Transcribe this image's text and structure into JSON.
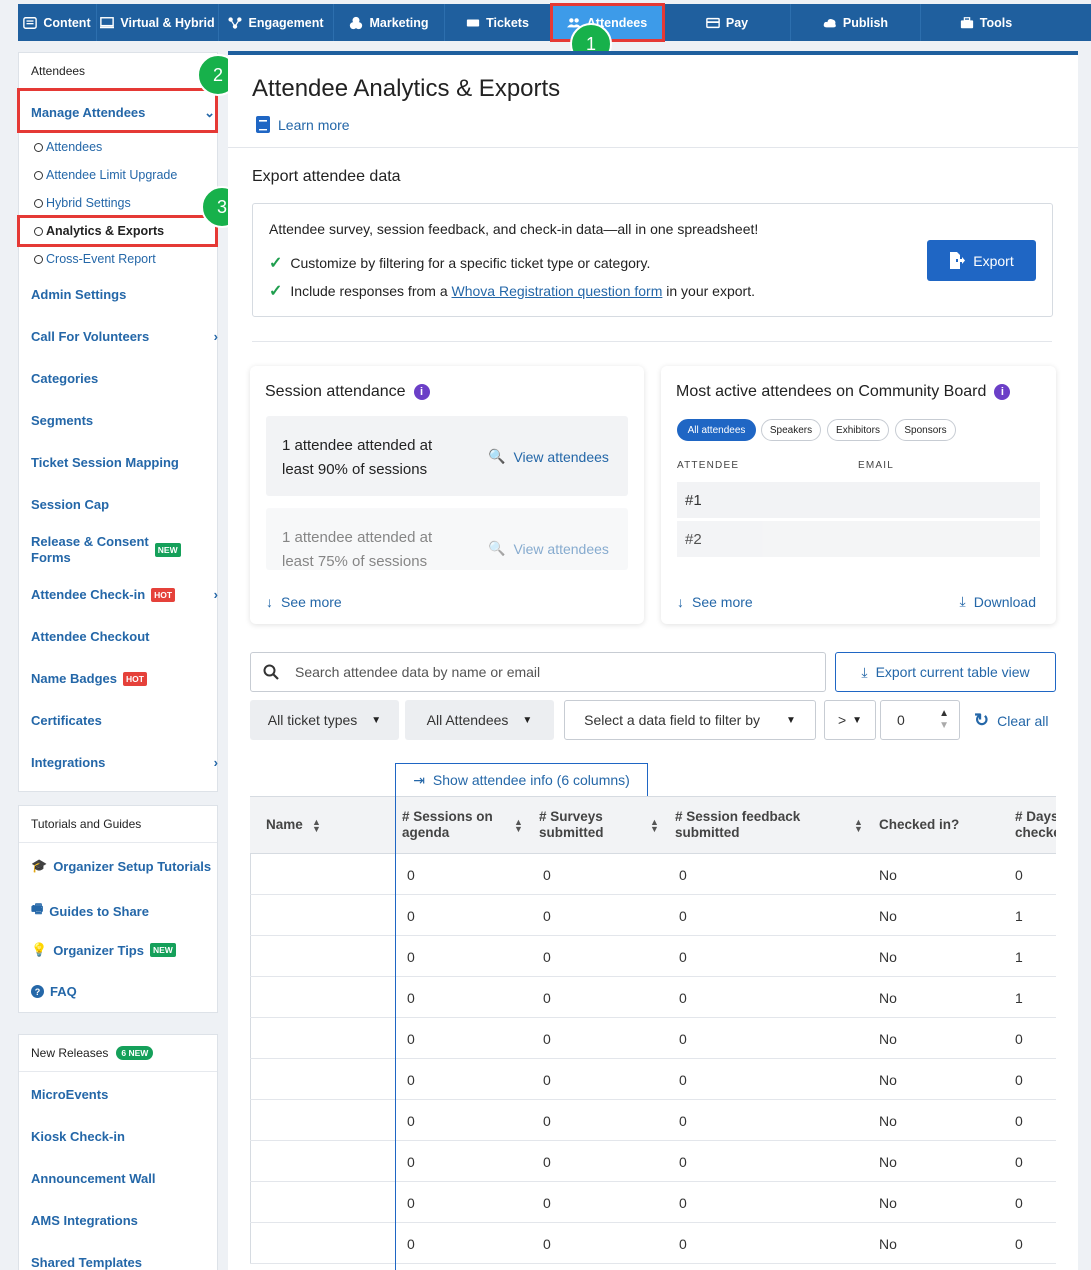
{
  "topnav": [
    {
      "label": "Content",
      "icon": "content-icon"
    },
    {
      "label": "Virtual & Hybrid",
      "icon": "monitor-icon"
    },
    {
      "label": "Engagement",
      "icon": "engagement-icon"
    },
    {
      "label": "Marketing",
      "icon": "marketing-icon"
    },
    {
      "label": "Tickets",
      "icon": "ticket-icon"
    },
    {
      "label": "Attendees",
      "icon": "attendees-icon",
      "active": true
    },
    {
      "label": "Pay",
      "icon": "card-icon"
    },
    {
      "label": "Publish",
      "icon": "cloud-upload-icon"
    },
    {
      "label": "Tools",
      "icon": "toolbox-icon"
    }
  ],
  "steps": [
    "1",
    "2",
    "3"
  ],
  "sidebar": {
    "header": "Attendees",
    "manage": "Manage Attendees",
    "sub": [
      "Attendees",
      "Attendee Limit Upgrade",
      "Hybrid Settings",
      "Analytics & Exports",
      "Cross-Event Report"
    ],
    "links": [
      {
        "label": "Admin Settings"
      },
      {
        "label": "Call For Volunteers",
        "chevron": true
      },
      {
        "label": "Categories"
      },
      {
        "label": "Segments"
      },
      {
        "label": "Ticket Session Mapping"
      },
      {
        "label": "Session Cap"
      },
      {
        "label": "Release & Consent",
        "label2": "Forms",
        "badge": "NEW"
      },
      {
        "label": "Attendee Check-in",
        "badge": "HOT",
        "chevron": true
      },
      {
        "label": "Attendee Checkout"
      },
      {
        "label": "Name Badges",
        "badge": "HOT"
      },
      {
        "label": "Certificates"
      },
      {
        "label": "Integrations",
        "chevron": true
      }
    ],
    "tutorials_header": "Tutorials and Guides",
    "tutorials": [
      {
        "label": "Organizer Setup Tutorials",
        "icon": "graduation-cap-icon"
      },
      {
        "label": "Guides to Share",
        "icon": "presentation-icon"
      },
      {
        "label": "Organizer Tips",
        "icon": "lightbulb-icon",
        "badge": "NEW"
      },
      {
        "label": "FAQ",
        "icon": "question-icon"
      }
    ],
    "releases_header": "New Releases",
    "releases_badge": "6 NEW",
    "releases": [
      "MicroEvents",
      "Kiosk Check-in",
      "Announcement Wall",
      "AMS Integrations",
      "Shared Templates"
    ]
  },
  "main": {
    "title": "Attendee Analytics & Exports",
    "learn_more": "Learn more",
    "export_section": "Export attendee data",
    "export_line1": "Attendee survey, session feedback, and check-in data—all in one spreadsheet!",
    "export_line2": "Customize by filtering for a specific ticket type or category.",
    "export_line3_pre": "Include responses from a",
    "export_line3_link": "Whova Registration question form",
    "export_line3_post": "in your export.",
    "export_button": "Export",
    "session_card": {
      "title": "Session attendance",
      "rows": [
        {
          "text": "1 attendee attended at least 90% of sessions",
          "link": "View attendees"
        },
        {
          "text": "1 attendee attended at least 75% of sessions",
          "link": "View attendees"
        }
      ],
      "see_more": "See more"
    },
    "board_card": {
      "title": "Most active attendees on Community Board",
      "pills": [
        "All attendees",
        "Speakers",
        "Exhibitors",
        "Sponsors"
      ],
      "col_attendee": "ATTENDEE",
      "col_email": "EMAIL",
      "rows": [
        "#1",
        "#2"
      ],
      "see_more": "See more",
      "download": "Download"
    },
    "search_placeholder": "Search attendee data by name or email",
    "export_table": "Export current table view",
    "filters": {
      "ticket": "All ticket types",
      "attendees": "All Attendees",
      "field": "Select a data field to filter by",
      "op": ">",
      "value": "0",
      "clear": "Clear all"
    },
    "show_info": "Show attendee info (6 columns)",
    "table": {
      "headers": [
        "Name",
        "# Sessions on agenda",
        "# Surveys submitted",
        "# Session feedback submitted",
        "Checked in?",
        "# Days checked"
      ],
      "rows": [
        [
          "",
          "0",
          "0",
          "0",
          "No",
          "0"
        ],
        [
          "",
          "0",
          "0",
          "0",
          "No",
          "1"
        ],
        [
          "",
          "0",
          "0",
          "0",
          "No",
          "1"
        ],
        [
          "",
          "0",
          "0",
          "0",
          "No",
          "1"
        ],
        [
          "",
          "0",
          "0",
          "0",
          "No",
          "0"
        ],
        [
          "",
          "0",
          "0",
          "0",
          "No",
          "0"
        ],
        [
          "",
          "0",
          "0",
          "0",
          "No",
          "0"
        ],
        [
          "",
          "0",
          "0",
          "0",
          "No",
          "0"
        ],
        [
          "",
          "0",
          "0",
          "0",
          "No",
          "0"
        ],
        [
          "",
          "0",
          "0",
          "0",
          "No",
          "0"
        ]
      ]
    }
  }
}
